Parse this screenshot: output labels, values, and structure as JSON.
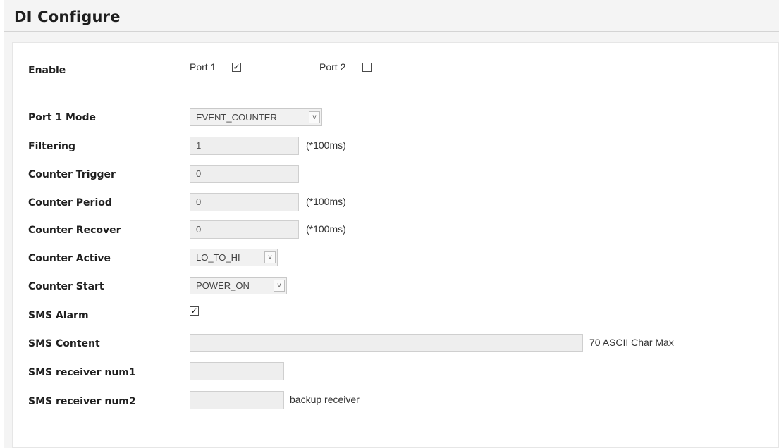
{
  "page": {
    "title": "DI Configure"
  },
  "enable": {
    "label": "Enable",
    "ports": [
      {
        "label": "Port 1",
        "checked": true
      },
      {
        "label": "Port 2",
        "checked": false
      }
    ]
  },
  "fields": {
    "port1_mode": {
      "label": "Port 1 Mode",
      "value": "EVENT_COUNTER"
    },
    "filtering": {
      "label": "Filtering",
      "value": "1",
      "unit": "(*100ms)"
    },
    "counter_trigger": {
      "label": "Counter Trigger",
      "value": "0"
    },
    "counter_period": {
      "label": "Counter Period",
      "value": "0",
      "unit": "(*100ms)"
    },
    "counter_recover": {
      "label": "Counter Recover",
      "value": "0",
      "unit": "(*100ms)"
    },
    "counter_active": {
      "label": "Counter Active",
      "value": "LO_TO_HI"
    },
    "counter_start": {
      "label": "Counter Start",
      "value": "POWER_ON"
    },
    "sms_alarm": {
      "label": "SMS Alarm",
      "checked": true
    },
    "sms_content": {
      "label": "SMS Content",
      "value": "",
      "hint": "70 ASCII Char Max"
    },
    "sms_receiver_num1": {
      "label": "SMS receiver num1",
      "value": ""
    },
    "sms_receiver_num2": {
      "label": "SMS receiver num2",
      "value": "",
      "hint": "backup receiver"
    }
  },
  "icons": {
    "checkmark": "check-icon",
    "dropdown": "chevron-down-icon"
  }
}
